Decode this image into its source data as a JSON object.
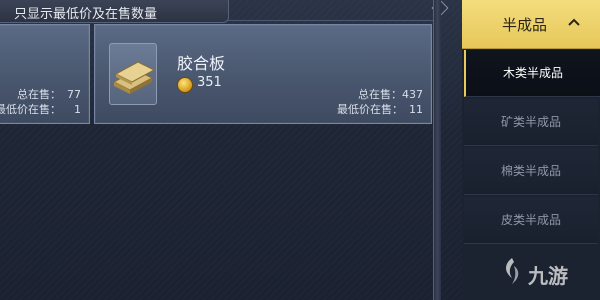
{
  "header": {
    "filter_label": "只显示最低价及在售数量"
  },
  "cards": [
    {
      "stats": {
        "total_label": "总在售：",
        "total_value": "77",
        "min_label": "最低价在售：",
        "min_value": "1"
      }
    },
    {
      "name": "胶合板",
      "price": "351",
      "stats": {
        "total_label": "总在售：",
        "total_value": "437",
        "min_label": "最低价在售：",
        "min_value": "11"
      }
    }
  ],
  "category": {
    "title": "半成品",
    "items": [
      {
        "label": "木类半成品",
        "active": true
      },
      {
        "label": "矿类半成品"
      },
      {
        "label": "棉类半成品"
      },
      {
        "label": "皮类半成品"
      }
    ]
  },
  "watermark": {
    "text": "九游"
  },
  "colors": {
    "accent_gold": "#e8c95b",
    "panel_bg": "#1b2230",
    "card_bg": "#4a5870"
  }
}
